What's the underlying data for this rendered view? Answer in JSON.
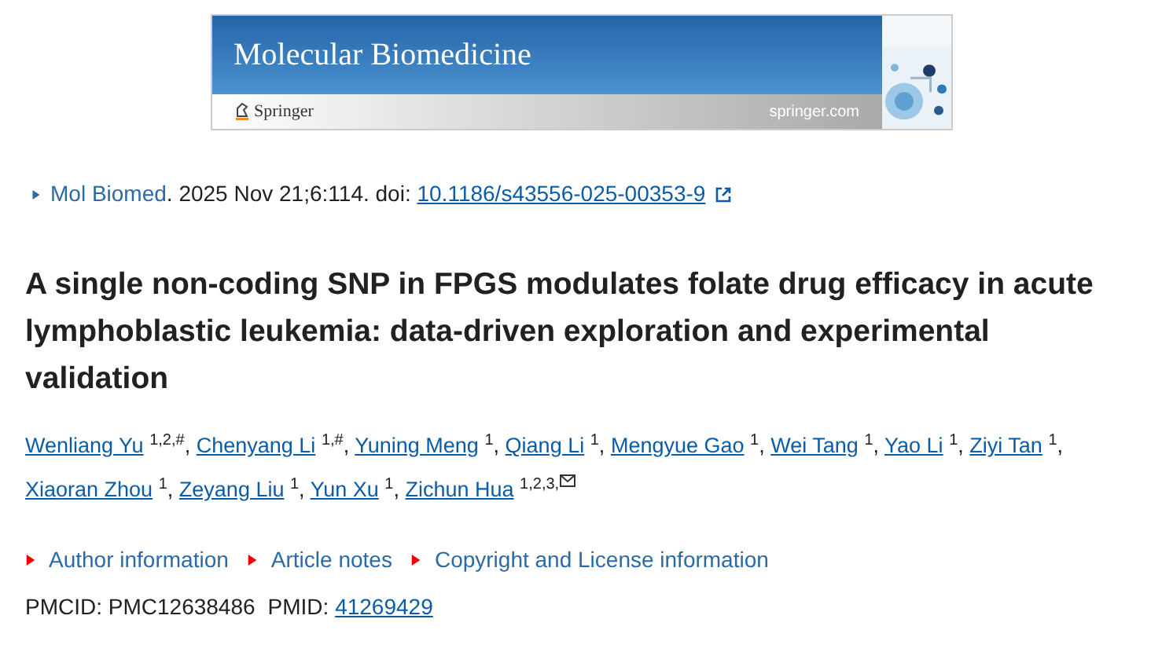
{
  "banner": {
    "journal_title": "Molecular Biomedicine",
    "publisher": "Springer",
    "website": "springer.com"
  },
  "citation": {
    "journal": "Mol Biomed",
    "details": ". 2025 Nov 21;6:114. doi: ",
    "doi": "10.1186/s43556-025-00353-9"
  },
  "title": "A single non-coding SNP in FPGS modulates folate drug efficacy in acute lymphoblastic leukemia: data-driven exploration and experimental validation",
  "authors": [
    {
      "name": "Wenliang Yu",
      "affiliations": "1,2,#",
      "corresponding": false,
      "separator": ","
    },
    {
      "name": "Chenyang Li",
      "affiliations": "1,#",
      "corresponding": false,
      "separator": ","
    },
    {
      "name": "Yuning Meng",
      "affiliations": "1",
      "corresponding": false,
      "separator": ","
    },
    {
      "name": "Qiang Li",
      "affiliations": "1",
      "corresponding": false,
      "separator": ","
    },
    {
      "name": "Mengyue Gao",
      "affiliations": "1",
      "corresponding": false,
      "separator": ","
    },
    {
      "name": "Wei Tang",
      "affiliations": "1",
      "corresponding": false,
      "separator": ","
    },
    {
      "name": "Yao Li",
      "affiliations": "1",
      "corresponding": false,
      "separator": ","
    },
    {
      "name": "Ziyi Tan",
      "affiliations": "1",
      "corresponding": false,
      "separator": ","
    },
    {
      "name": "Xiaoran Zhou",
      "affiliations": "1",
      "corresponding": false,
      "separator": ","
    },
    {
      "name": "Zeyang Liu",
      "affiliations": "1",
      "corresponding": false,
      "separator": ","
    },
    {
      "name": "Yun Xu",
      "affiliations": "1",
      "corresponding": false,
      "separator": ","
    },
    {
      "name": "Zichun Hua",
      "affiliations": "1,2,3,",
      "corresponding": true
    }
  ],
  "info_links": [
    {
      "label": "Author information",
      "expanded": false
    },
    {
      "label": "Article notes",
      "expanded": false
    },
    {
      "label": "Copyright and License information",
      "expanded": false
    }
  ],
  "ids": {
    "pmcid_label": "PMCID:",
    "pmcid": "PMC12638486",
    "pmid_label": "PMID:",
    "pmid": "41269429"
  }
}
